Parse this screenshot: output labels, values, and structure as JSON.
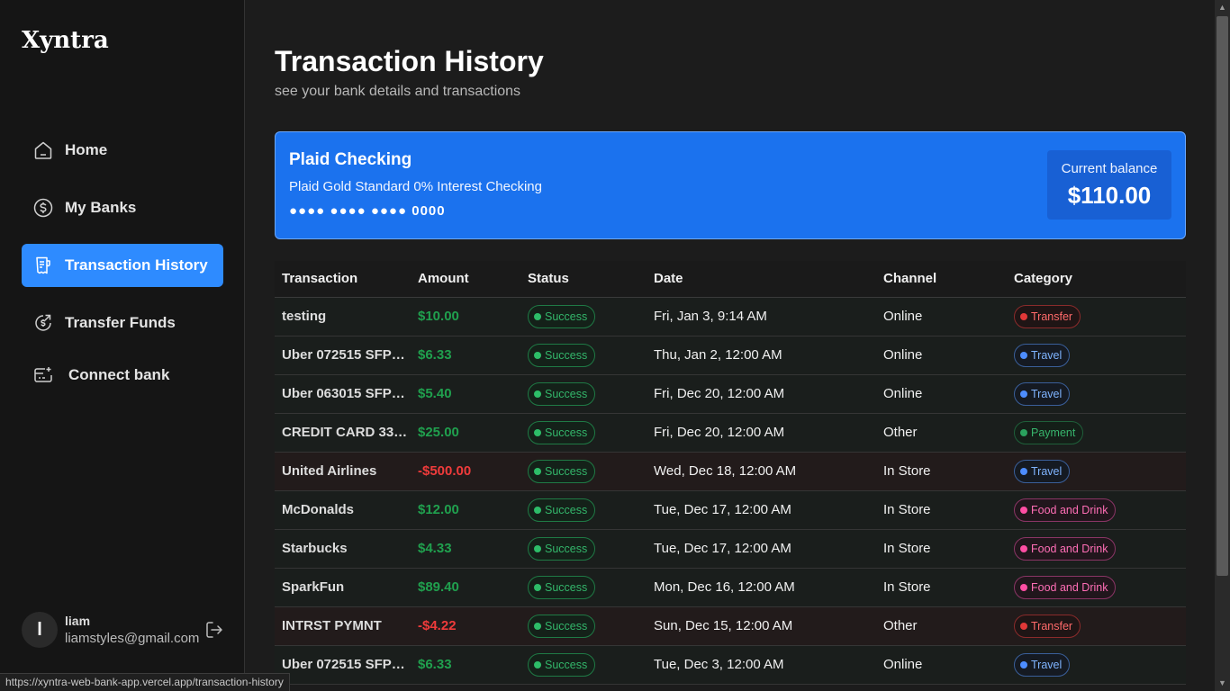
{
  "app": {
    "logo": "Xyntra"
  },
  "sidebar": {
    "items": [
      {
        "label": "Home",
        "icon": "home-icon"
      },
      {
        "label": "My Banks",
        "icon": "dollar-circle-icon"
      },
      {
        "label": "Transaction History",
        "icon": "receipt-icon",
        "active": true
      },
      {
        "label": "Transfer Funds",
        "icon": "money-send-icon"
      },
      {
        "label": "Connect bank",
        "icon": "card-add-icon"
      }
    ],
    "user": {
      "initial": "l",
      "name": "liam",
      "email": "liamstyles@gmail.com"
    }
  },
  "header": {
    "title": "Transaction History",
    "subtitle": "see your bank details and transactions"
  },
  "bank_card": {
    "name": "Plaid Checking",
    "official_name": "Plaid Gold Standard 0% Interest Checking",
    "mask": "●●●● ●●●● ●●●● 0000",
    "balance_label": "Current balance",
    "balance": "$110.00"
  },
  "table": {
    "columns": [
      "Transaction",
      "Amount",
      "Status",
      "Date",
      "Channel",
      "Category"
    ],
    "rows": [
      {
        "name": "testing",
        "amount": "$10.00",
        "type": "pos",
        "status": "Success",
        "date": "Fri, Jan 3, 9:14 AM",
        "channel": "Online",
        "category": "Transfer",
        "cat_class": "transfer"
      },
      {
        "name": "Uber 072515 SFP…",
        "amount": "$6.33",
        "type": "pos",
        "status": "Success",
        "date": "Thu, Jan 2, 12:00 AM",
        "channel": "Online",
        "category": "Travel",
        "cat_class": "travel"
      },
      {
        "name": "Uber 063015 SFP…",
        "amount": "$5.40",
        "type": "pos",
        "status": "Success",
        "date": "Fri, Dec 20, 12:00 AM",
        "channel": "Online",
        "category": "Travel",
        "cat_class": "travel"
      },
      {
        "name": "CREDIT CARD 33…",
        "amount": "$25.00",
        "type": "pos",
        "status": "Success",
        "date": "Fri, Dec 20, 12:00 AM",
        "channel": "Other",
        "category": "Payment",
        "cat_class": "payment"
      },
      {
        "name": "United Airlines",
        "amount": "-$500.00",
        "type": "neg",
        "status": "Success",
        "date": "Wed, Dec 18, 12:00 AM",
        "channel": "In Store",
        "category": "Travel",
        "cat_class": "travel"
      },
      {
        "name": "McDonalds",
        "amount": "$12.00",
        "type": "pos",
        "status": "Success",
        "date": "Tue, Dec 17, 12:00 AM",
        "channel": "In Store",
        "category": "Food and Drink",
        "cat_class": "food"
      },
      {
        "name": "Starbucks",
        "amount": "$4.33",
        "type": "pos",
        "status": "Success",
        "date": "Tue, Dec 17, 12:00 AM",
        "channel": "In Store",
        "category": "Food and Drink",
        "cat_class": "food"
      },
      {
        "name": "SparkFun",
        "amount": "$89.40",
        "type": "pos",
        "status": "Success",
        "date": "Mon, Dec 16, 12:00 AM",
        "channel": "In Store",
        "category": "Food and Drink",
        "cat_class": "food"
      },
      {
        "name": "INTRST PYMNT",
        "amount": "-$4.22",
        "type": "neg",
        "status": "Success",
        "date": "Sun, Dec 15, 12:00 AM",
        "channel": "Other",
        "category": "Transfer",
        "cat_class": "transfer"
      },
      {
        "name": "Uber 072515 SFP…",
        "amount": "$6.33",
        "type": "pos",
        "status": "Success",
        "date": "Tue, Dec 3, 12:00 AM",
        "channel": "Online",
        "category": "Travel",
        "cat_class": "travel"
      }
    ]
  },
  "status_bar": {
    "url": "https://xyntra-web-bank-app.vercel.app/transaction-history"
  },
  "colors": {
    "accent": "#2e8bff",
    "card": "#1b72ee",
    "positive": "#20a04e",
    "negative": "#ef3b3b"
  }
}
